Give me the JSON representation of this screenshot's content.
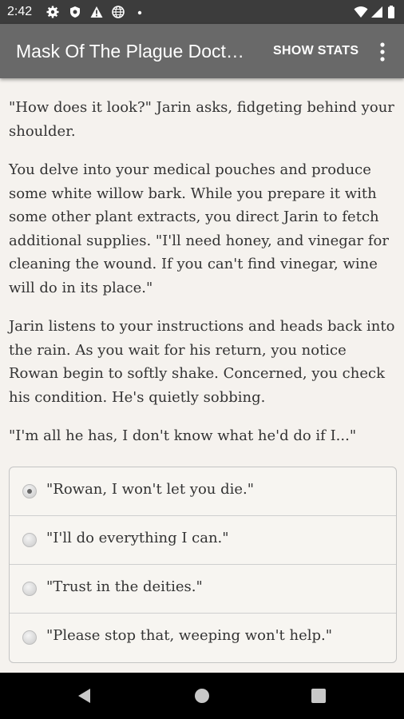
{
  "status_bar": {
    "time": "2:42",
    "left_icons": [
      "gear-icon",
      "shield-icon",
      "warning-icon",
      "globe-icon",
      "dot-icon"
    ],
    "right_icons": [
      "wifi-icon",
      "signal-icon",
      "battery-icon"
    ]
  },
  "app_bar": {
    "title": "Mask Of The Plague Doct…",
    "show_stats_label": "SHOW STATS",
    "more_icon": "more-vert-icon"
  },
  "story": {
    "paragraphs": [
      "\"How does it look?\" Jarin asks, fidgeting behind your shoulder.",
      "You delve into your medical pouches and produce some white willow bark. While you prepare it with some other plant extracts, you direct Jarin to fetch additional supplies. \"I'll need honey, and vinegar for cleaning the wound. If you can't find vinegar, wine will do in its place.\"",
      "Jarin listens to your instructions and heads back into the rain. As you wait for his return, you notice Rowan begin to softly shake. Concerned, you check his condition. He's quietly sobbing.",
      "\"I'm all he has, I don't know what he'd do if I...\""
    ]
  },
  "choices": {
    "selected_index": 0,
    "options": [
      "\"Rowan, I won't let you die.\"",
      "\"I'll do everything I can.\"",
      "\"Trust in the deities.\"",
      "\"Please stop that, weeping won't help.\""
    ]
  },
  "nav_bar": {
    "icons": [
      "back-icon",
      "home-icon",
      "recents-icon"
    ]
  },
  "colors": {
    "status_bar": "#3c3c3c",
    "app_bar": "#696969",
    "page_background": "#f5f2ee",
    "text": "#333333",
    "nav_bar": "#000000"
  }
}
